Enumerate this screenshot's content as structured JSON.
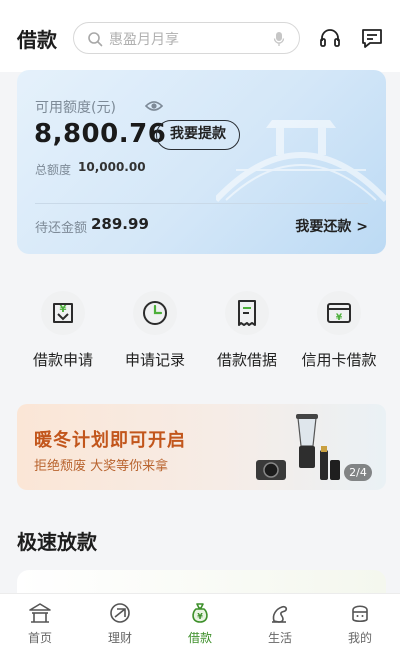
{
  "header": {
    "title": "借款",
    "search_placeholder": "惠盈月月享"
  },
  "quota_card": {
    "label": "可用额度(元)",
    "amount": "8,800.76",
    "withdraw_button": "我要提款",
    "total_label": "总额度",
    "total_value": "10,000.00",
    "due_label": "待还金额",
    "due_value": "289.99",
    "repay_link": "我要还款 >"
  },
  "quick_actions": [
    {
      "label": "借款申请",
      "icon": "loan-apply-icon"
    },
    {
      "label": "申请记录",
      "icon": "clock-icon"
    },
    {
      "label": "借款借据",
      "icon": "receipt-icon"
    },
    {
      "label": "信用卡借款",
      "icon": "credit-card-icon"
    }
  ],
  "banner": {
    "title": "暖冬计划即可开启",
    "subtitle": "拒绝颓废  大奖等你来拿",
    "pager": "2/4"
  },
  "section": {
    "title": "极速放款"
  },
  "tabbar": [
    {
      "label": "首页",
      "icon": "home-pavilion-icon",
      "active": false
    },
    {
      "label": "理财",
      "icon": "finance-icon",
      "active": false
    },
    {
      "label": "借款",
      "icon": "money-bag-icon",
      "active": true
    },
    {
      "label": "生活",
      "icon": "life-icon",
      "active": false
    },
    {
      "label": "我的",
      "icon": "profile-icon",
      "active": false
    }
  ],
  "colors": {
    "accent_green": "#3d8f2a",
    "banner_title": "#c2561c",
    "card_blue": "#d4e7f8"
  }
}
